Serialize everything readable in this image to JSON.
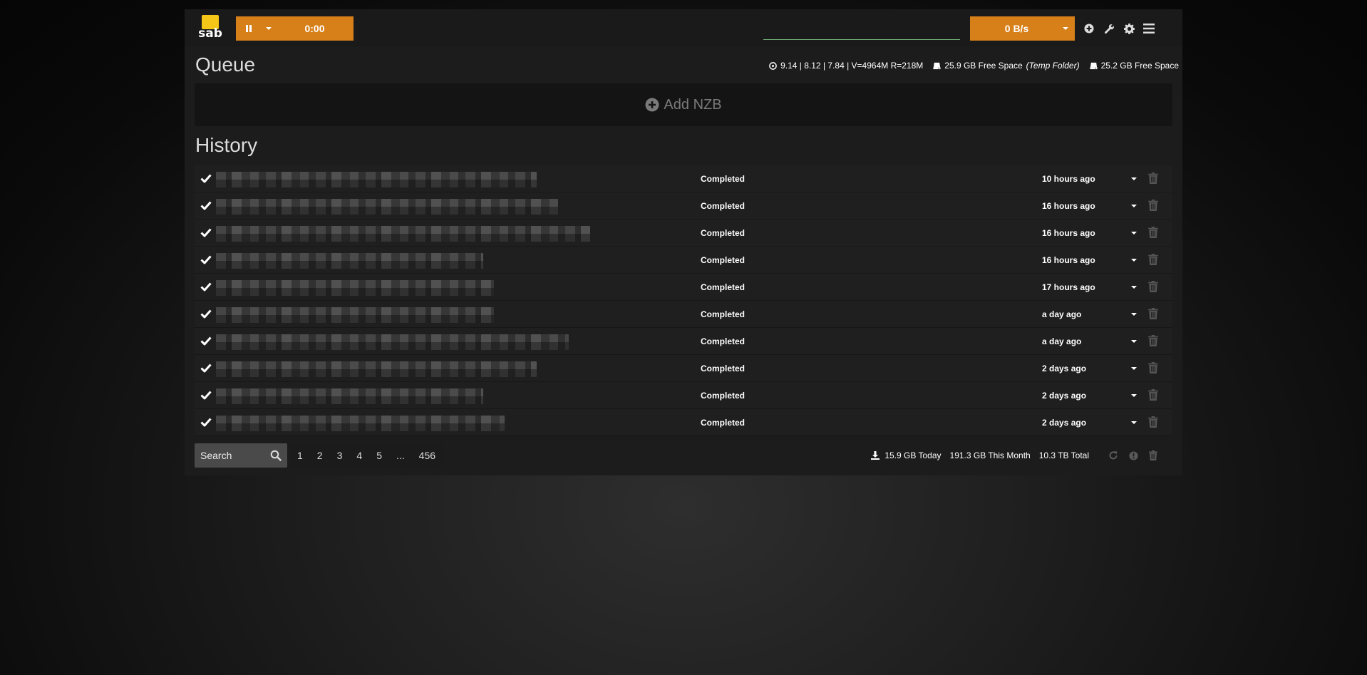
{
  "header": {
    "logo_text": "sab",
    "queue_timer": "0:00",
    "speed": "0 B/s",
    "accent_color": "#d7801a",
    "logo_color": "#f5c518"
  },
  "queue": {
    "title": "Queue",
    "sysload": "9.14 | 8.12 | 7.84 | V=4964M R=218M",
    "temp_space": "25.9 GB Free Space",
    "temp_label": "(Temp Folder)",
    "free_space": "25.2 GB Free Space",
    "add_nzb_label": "Add NZB"
  },
  "history": {
    "title": "History",
    "rows": [
      {
        "status": "Completed",
        "time": "10 hours ago"
      },
      {
        "status": "Completed",
        "time": "16 hours ago"
      },
      {
        "status": "Completed",
        "time": "16 hours ago"
      },
      {
        "status": "Completed",
        "time": "16 hours ago"
      },
      {
        "status": "Completed",
        "time": "17 hours ago"
      },
      {
        "status": "Completed",
        "time": "a day ago"
      },
      {
        "status": "Completed",
        "time": "a day ago"
      },
      {
        "status": "Completed",
        "time": "2 days ago"
      },
      {
        "status": "Completed",
        "time": "2 days ago"
      },
      {
        "status": "Completed",
        "time": "2 days ago"
      }
    ]
  },
  "footer": {
    "search_placeholder": "Search",
    "pages": [
      "1",
      "2",
      "3",
      "4",
      "5",
      "...",
      "456"
    ],
    "today": "15.9 GB Today",
    "month": "191.3 GB This Month",
    "total": "10.3 TB Total"
  },
  "icons": {
    "pause": "pause-icon",
    "add": "plus-circle-icon",
    "config": "wrench-icon",
    "settings": "gear-icon",
    "menu": "hamburger-menu-icon",
    "download": "download-icon",
    "refresh": "refresh-icon",
    "info": "info-icon",
    "trash": "trash-icon"
  }
}
